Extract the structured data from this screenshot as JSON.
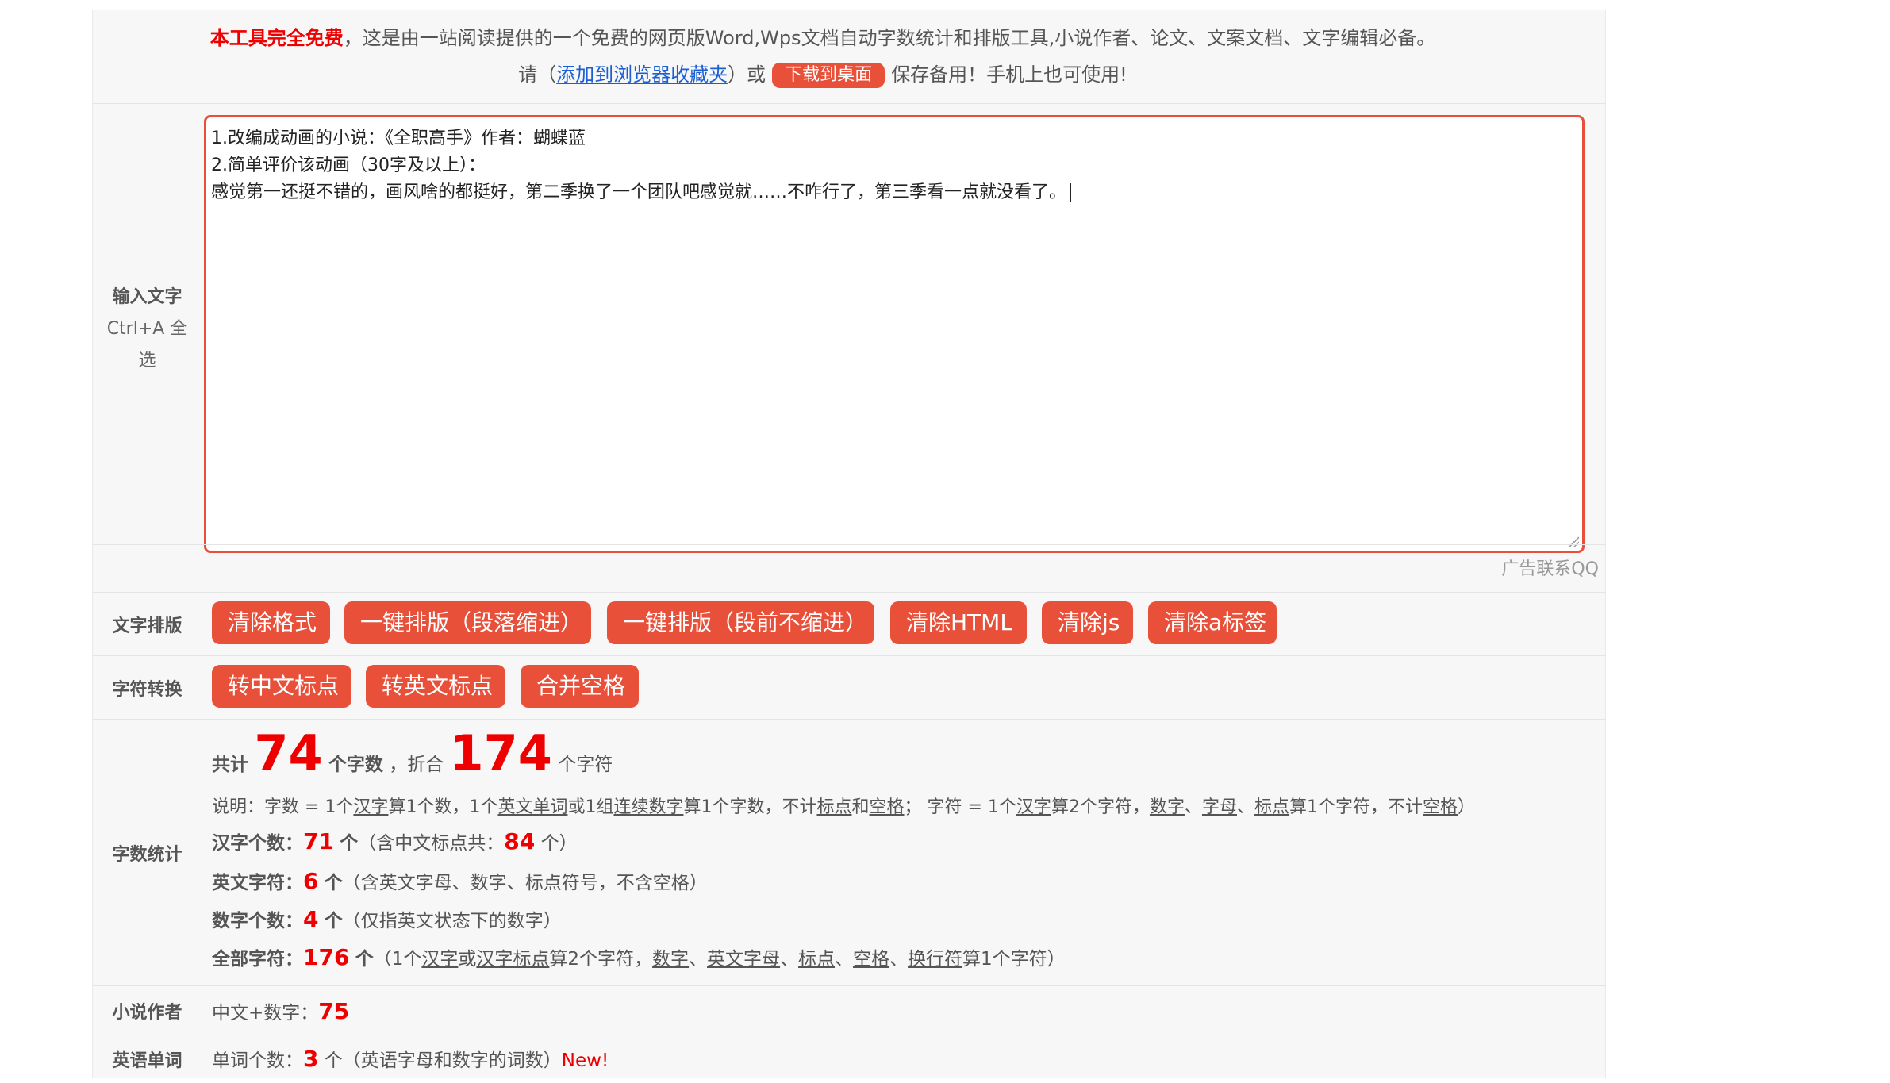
{
  "header": {
    "free_label": "本工具完全免费",
    "intro_text": "，这是由一站阅读提供的一个免费的网页版Word,Wps文档自动字数统计和排版工具,小说作者、论文、文案文档、文字编辑必备。",
    "please": "请（",
    "bookmark_link": "添加到浏览器收藏夹",
    "or": "）或",
    "download_button": "下载到桌面",
    "save_hint": "保存备用！手机上也可使用!"
  },
  "input": {
    "label": "输入文字",
    "hint_line1": "Ctrl+A 全",
    "hint_line2": "选",
    "lines": [
      "1.改编成动画的小说：《全职高手》作者：蝴蝶蓝",
      "2.简单评价该动画（30字及以上）：",
      "感觉第一还挺不错的，画风啥的都挺好，第二季换了一个团队吧感觉就……不咋行了，第三季看一点就没看了。"
    ]
  },
  "ad": {
    "text": "广告联系QQ"
  },
  "format": {
    "label": "文字排版",
    "buttons": [
      "清除格式",
      "一键排版（段落缩进）",
      "一键排版（段前不缩进）",
      "清除HTML",
      "清除js",
      "清除a标签"
    ]
  },
  "convert": {
    "label": "字符转换",
    "buttons": [
      "转中文标点",
      "转英文标点",
      "合并空格"
    ]
  },
  "stats": {
    "label": "字数统计",
    "total_prefix": "共计",
    "word_count": "74",
    "word_unit": "个字数",
    "sep": "，折合",
    "char_count": "174",
    "char_unit": "个字符",
    "explain": {
      "a": "说明：字数 = 1个",
      "hanzi": "汉字",
      "b": "算1个数，1个",
      "english_word": "英文单词",
      "c": "或1组",
      "continuous_digits": "连续数字",
      "d": "算1个字数，不计",
      "punct": "标点",
      "e": "和",
      "space": "空格",
      "f": "；  字符 = 1个",
      "hanzi2": "汉字",
      "g": "算2个字符，",
      "digit": "数字",
      "h": "、",
      "letter": "字母",
      "i": "、",
      "punct2": "标点",
      "j": "算1个字符，不计",
      "space2": "空格",
      "k": "）"
    },
    "hanzi": {
      "label": "汉字个数：",
      "value": "71",
      "unit": "个",
      "note_a": "（含中文标点共：",
      "punct_value": "84",
      "note_b": "个）"
    },
    "english": {
      "label": "英文字符：",
      "value": "6",
      "unit": "个",
      "note": "（含英文字母、数字、标点符号，不含空格）"
    },
    "digits": {
      "label": "数字个数：",
      "value": "4",
      "unit": "个",
      "note": "（仅指英文状态下的数字）"
    },
    "all": {
      "label": "全部字符：",
      "value": "176",
      "unit": "个",
      "a": "（1个",
      "hanzi": "汉字",
      "b": "或",
      "hanzi_punct": "汉字标点",
      "c": "算2个字符，",
      "digit": "数字",
      "d": "、",
      "letter": "英文字母",
      "e": "、",
      "punct": "标点",
      "f": "、",
      "space": "空格",
      "g": "、",
      "newline": "换行符",
      "h": "算1个字符）"
    }
  },
  "novel": {
    "label": "小说作者",
    "text": "中文+数字：",
    "value": "75"
  },
  "words": {
    "label": "英语单词",
    "text": "单词个数：",
    "value": "3",
    "note": "个（英语字母和数字的词数）",
    "new": "New!"
  }
}
